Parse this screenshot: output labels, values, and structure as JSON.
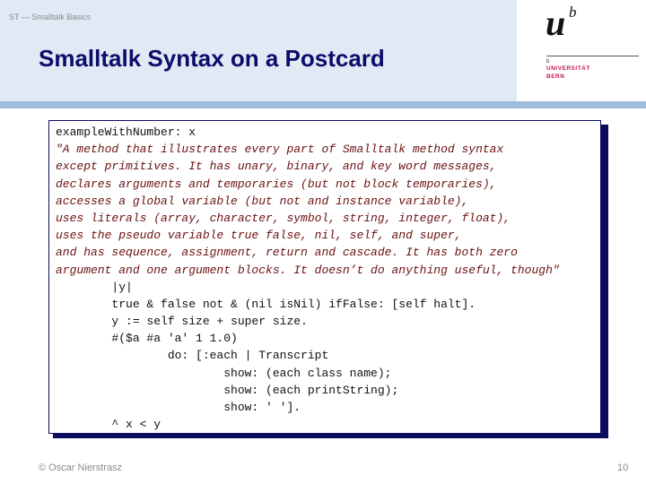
{
  "header": {
    "course_label": "ST — Smalltalk Basics",
    "title": "Smalltalk Syntax on a Postcard"
  },
  "logo": {
    "mark_main": "u",
    "mark_super": "b",
    "small_mark": "b",
    "line1": "UNIVERSITÄT",
    "line2": "BERN",
    "text_color": "#c4174a"
  },
  "code": {
    "lines": [
      {
        "text": "exampleWithNumber: x",
        "style": "code"
      },
      {
        "text": "\"A method that illustrates every part of Smalltalk method syntax",
        "style": "comment"
      },
      {
        "text": "except primitives. It has unary, binary, and key word messages,",
        "style": "comment"
      },
      {
        "text": "declares arguments and temporaries (but not block temporaries),",
        "style": "comment"
      },
      {
        "text": "accesses a global variable (but not and instance variable),",
        "style": "comment"
      },
      {
        "text": "uses literals (array, character, symbol, string, integer, float),",
        "style": "comment"
      },
      {
        "text": "uses the pseudo variable true false, nil, self, and super,",
        "style": "comment"
      },
      {
        "text": "and has sequence, assignment, return and cascade. It has both zero",
        "style": "comment"
      },
      {
        "text": "argument and one argument blocks. It doesn’t do anything useful, though\"",
        "style": "comment"
      },
      {
        "text": "        |y|",
        "style": "code"
      },
      {
        "text": "        true & false not & (nil isNil) ifFalse: [self halt].",
        "style": "code"
      },
      {
        "text": "        y := self size + super size.",
        "style": "code"
      },
      {
        "text": "        #($a #a 'a' 1 1.0)",
        "style": "code"
      },
      {
        "text": "                do: [:each | Transcript",
        "style": "code"
      },
      {
        "text": "                        show: (each class name);",
        "style": "code"
      },
      {
        "text": "                        show: (each printString);",
        "style": "code"
      },
      {
        "text": "                        show: ' '].",
        "style": "code"
      },
      {
        "text": "        ^ x < y",
        "style": "code"
      }
    ]
  },
  "footer": {
    "author": "© Oscar Nierstrasz",
    "page_number": "10"
  }
}
